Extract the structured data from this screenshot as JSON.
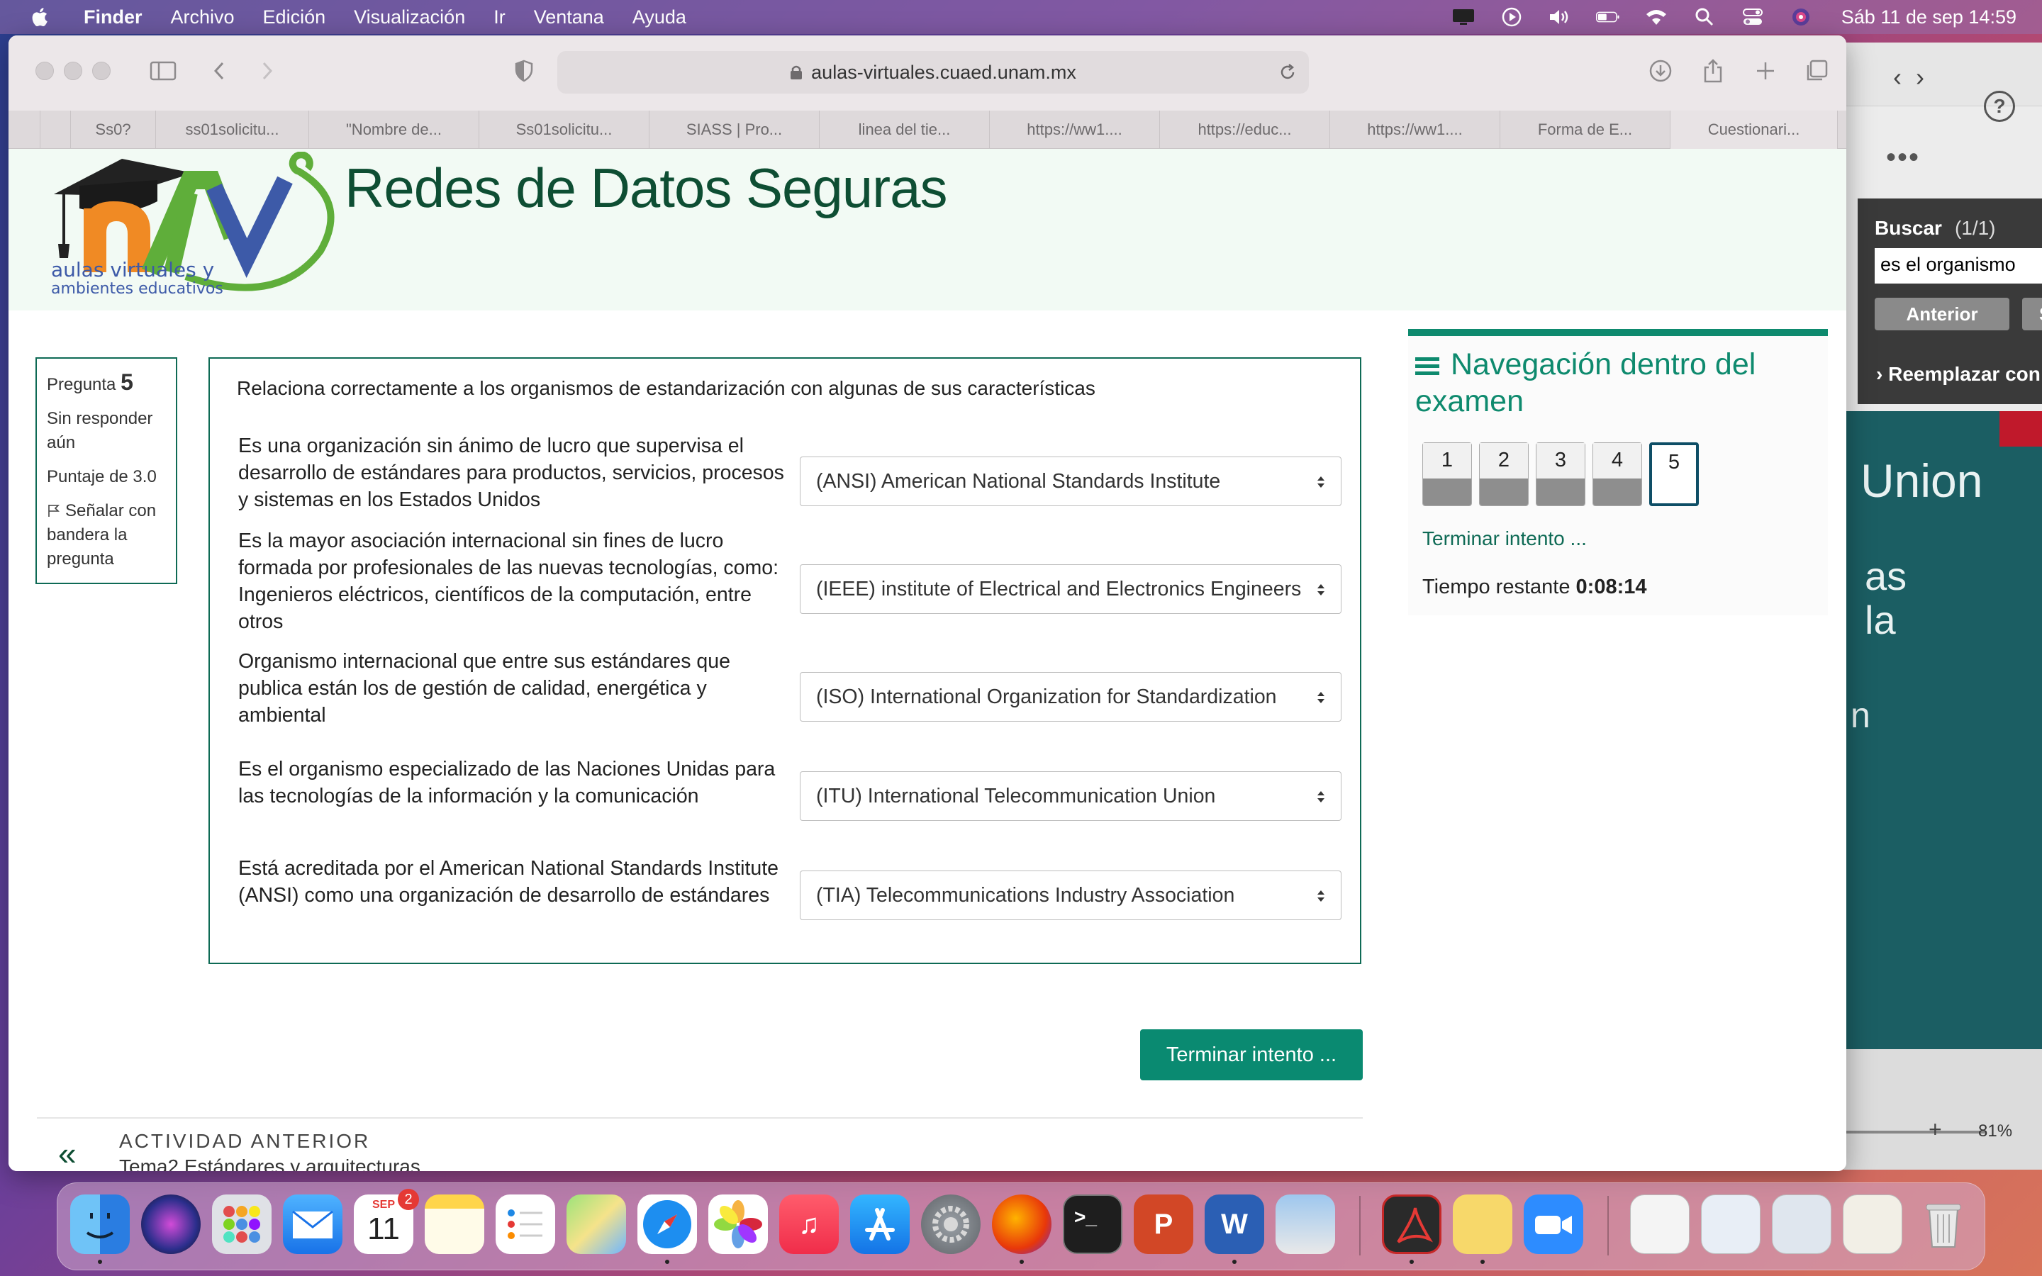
{
  "menubar": {
    "app": "Finder",
    "items": [
      "Archivo",
      "Edición",
      "Visualización",
      "Ir",
      "Ventana",
      "Ayuda"
    ],
    "clock": "Sáb 11 de sep  14:59"
  },
  "browser": {
    "url": "aulas-virtuales.cuaed.unam.mx",
    "tabs": [
      "Ss0?",
      "ss01solicitu...",
      "\"Nombre de...",
      "Ss01solicitu...",
      "SIASS | Pro...",
      "linea del tie...",
      "https://ww1....",
      "https://educ...",
      "https://ww1....",
      "Forma de E...",
      "Cuestionari..."
    ]
  },
  "site": {
    "logo_text_line1": "aulas virtuales y",
    "logo_text_line2": "ambientes educativos",
    "course_title": "Redes de Datos Seguras"
  },
  "question_info": {
    "label": "Pregunta",
    "number": "5",
    "status": "Sin responder aún",
    "score": "Puntaje de 3.0",
    "flag": "Señalar con bandera la pregunta"
  },
  "question": {
    "text": "Relaciona correctamente a los organismos de estandarización con algunas de sus características",
    "rows": [
      {
        "text": "Es una organización sin ánimo de lucro que supervisa el desarrollo de estándares para productos, servicios, procesos y sistemas en los Estados Unidos",
        "selected": "(ANSI) American National Standards Institute"
      },
      {
        "text": "Es la mayor asociación internacional sin fines de lucro formada por profesionales de las nuevas tecnologías, como: Ingenieros eléctricos, científicos de la computación, entre otros",
        "selected": "(IEEE) institute of Electrical and Electronics Engineers"
      },
      {
        "text": "Organismo internacional que entre sus estándares que publica están los de gestión de calidad, energética y ambiental",
        "selected": "(ISO) International Organization for Standardization"
      },
      {
        "text": "Es el organismo especializado de las Naciones Unidas para las tecnologías de la información y la comunicación",
        "selected": "(ITU) International Telecommunication Union"
      },
      {
        "text": "Está acreditada por el American National Standards Institute (ANSI) como una organización de desarrollo de estándares",
        "selected": "(TIA) Telecommunications Industry Association"
      }
    ]
  },
  "finish_button": "Terminar intento ...",
  "previous": {
    "label": "ACTIVIDAD ANTERIOR",
    "title": "Tema2 Estándares y arquitecturas"
  },
  "nav": {
    "title": "Navegación dentro del examen",
    "questions": [
      "1",
      "2",
      "3",
      "4",
      "5"
    ],
    "current": "5",
    "finish_link": "Terminar intento ...",
    "time_label": "Tiempo restante",
    "time_value": "0:08:14"
  },
  "side_window": {
    "find_label": "Buscar",
    "find_count": "(1/1)",
    "find_value": "es el organismo",
    "prev_button": "Anterior",
    "next_button": "S",
    "replace_label": "Reemplazar con",
    "slide_text_1": "Union",
    "slide_text_2": "as",
    "slide_text_3": "la",
    "slide_text_4": "n",
    "zoom": "81%"
  },
  "dock": {
    "calendar_month": "SEP",
    "calendar_day": "11",
    "calendar_badge": "2"
  },
  "colors": {
    "accent": "#0a8a71",
    "title_green": "#0e4e33",
    "nav_green": "#0e8a6e"
  }
}
